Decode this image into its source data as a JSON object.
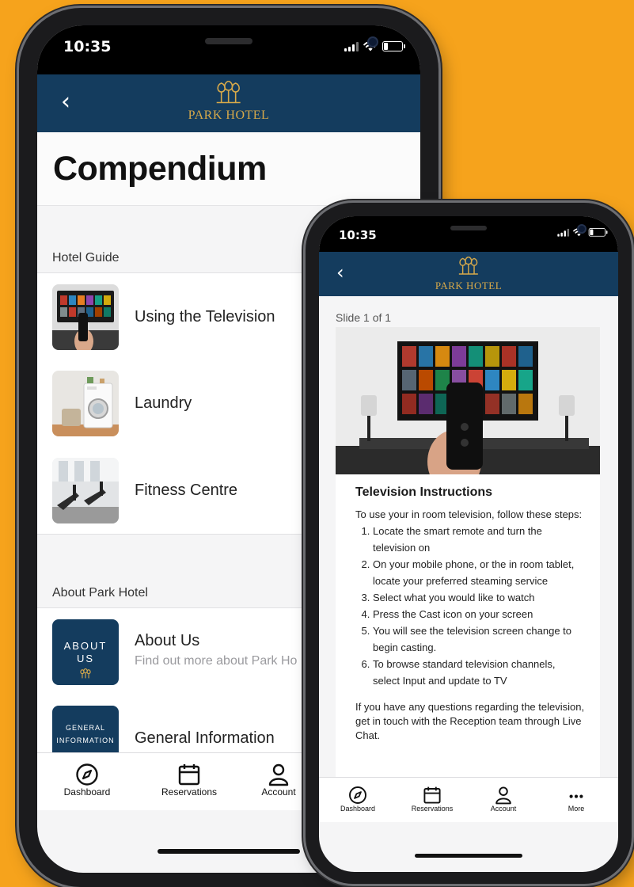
{
  "left_phone": {
    "status_time": "10:35",
    "brand": "PARK HOTEL",
    "page_title": "Compendium",
    "sections": [
      {
        "title": "Hotel Guide",
        "items": [
          {
            "title": "Using the Television",
            "subtitle": ""
          },
          {
            "title": "Laundry",
            "subtitle": ""
          },
          {
            "title": "Fitness Centre",
            "subtitle": ""
          }
        ]
      },
      {
        "title": "About Park Hotel",
        "items": [
          {
            "title": "About Us",
            "subtitle": "Find out more about Park Ho",
            "thumb_text": [
              "ABOUT",
              "US"
            ]
          },
          {
            "title": "General Information",
            "subtitle": "",
            "thumb_text": [
              "GENERAL",
              "INFORMATION"
            ]
          }
        ]
      }
    ],
    "tabs": [
      {
        "label": "Dashboard",
        "icon": "compass-icon"
      },
      {
        "label": "Reservations",
        "icon": "calendar-icon"
      },
      {
        "label": "Account",
        "icon": "person-icon"
      }
    ]
  },
  "right_phone": {
    "status_time": "10:35",
    "brand": "PARK HOTEL",
    "slide_label": "Slide 1 of 1",
    "card_title": "Television Instructions",
    "intro": "To use your in room television, follow these steps:",
    "steps": [
      "Locate the smart remote and turn the television on",
      "On your mobile phone, or the in room tablet, locate your preferred steaming service",
      "Select what you would like to watch",
      "Press the Cast icon on your screen",
      "You will see the television screen change to begin casting.",
      "To browse standard television channels, select Input and update to TV"
    ],
    "footer": "If you have any questions regarding the television, get in touch with the Reception team through Live Chat.",
    "tabs": [
      {
        "label": "Dashboard",
        "icon": "compass-icon"
      },
      {
        "label": "Reservations",
        "icon": "calendar-icon"
      },
      {
        "label": "Account",
        "icon": "person-icon"
      },
      {
        "label": "More",
        "icon": "more-icon"
      }
    ]
  },
  "colors": {
    "background": "#f6a31c",
    "navbar": "#143c5e",
    "brand_gold": "#d7a94a",
    "about_tile": "#143c5e"
  }
}
